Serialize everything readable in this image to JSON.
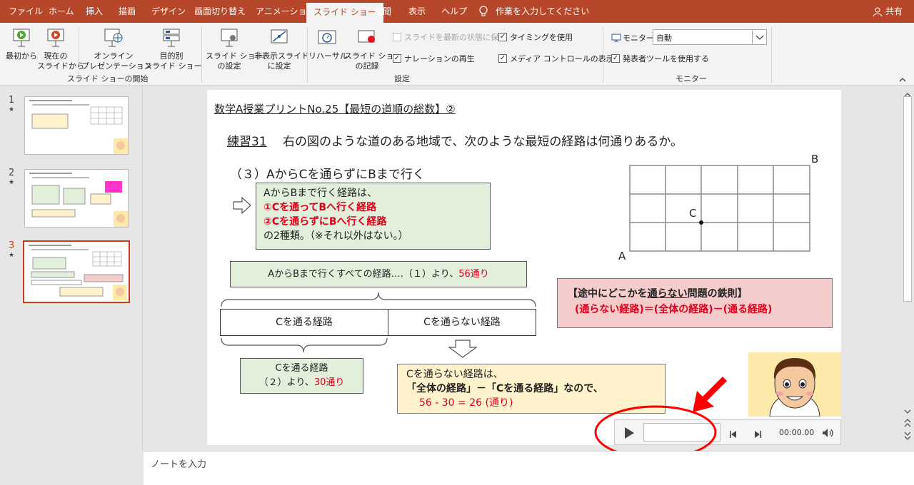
{
  "tabs": [
    "ファイル",
    "ホーム",
    "挿入",
    "描画",
    "デザイン",
    "画面切り替え",
    "アニメーション",
    "スライド ショー",
    "校閲",
    "表示",
    "ヘルプ"
  ],
  "tell_me": "作業を入力してください",
  "share": "共有",
  "ribbon": {
    "from_beginning": "最初から",
    "from_current_1": "現在の",
    "from_current_2": "スライドから",
    "online_1": "オンライン",
    "online_2": "プレゼンテーション",
    "custom_1": "目的別",
    "custom_2": "スライド ショー",
    "group_start": "スライド ショーの開始",
    "setup_1": "スライド ショー",
    "setup_2": "の設定",
    "hide_1": "非表示スライド",
    "hide_2": "に設定",
    "rehearse": "リハーサル",
    "record_1": "スライド ショー",
    "record_2": "の記録",
    "keep_updated": "スライドを最新の状態に保つ",
    "narration": "ナレーションの再生",
    "timings": "タイミングを使用",
    "media_controls": "メディア コントロールの表示",
    "group_setup": "設定",
    "monitor_label": "モニター:",
    "monitor_value": "自動",
    "presenter_view": "発表者ツールを使用する",
    "group_monitor": "モニター"
  },
  "thumbs": [
    "1",
    "2",
    "3"
  ],
  "slide": {
    "title": "数学A授業プリントNo.25【最短の道順の総数】②",
    "exercise_label": "練習31",
    "exercise_text": "右の図のような道のある地域で、次のような最短の経路は何通りあるか。",
    "sub_q": "（３）AからCを通らずにBまで行く",
    "box1_l1": "AからBまで行く経路は、",
    "box1_l2": "①Cを通ってBへ行く経路",
    "box1_l3": "②Cを通らずにBへ行く経路",
    "box1_l4": "の2種類。（※それ以外はない。）",
    "total_a": "AからBまで行くすべての経路‥‥（１）より、",
    "total_b": "56通り",
    "via_c": "Cを通る経路",
    "not_via_c": "Cを通らない経路",
    "via_box_1": "Cを通る経路",
    "via_box_2a": "（２）より、",
    "via_box_2b": "30通り",
    "notvia_1": "Cを通らない経路は、",
    "notvia_2": "「全体の経路」－「Cを通る経路」なので、",
    "notvia_3": "56 - 30 = 26 (通り)",
    "rule_title_a": "【途中にどこかを",
    "rule_title_u": "通らない",
    "rule_title_b": "問題の鉄則】",
    "rule_formula": "(通らない経路)＝(全体の経路)－(通る経路)",
    "label_a": "A",
    "label_b": "B",
    "label_c": "C"
  },
  "media": {
    "time": "00:00.00"
  },
  "notes_placeholder": "ノートを入力"
}
